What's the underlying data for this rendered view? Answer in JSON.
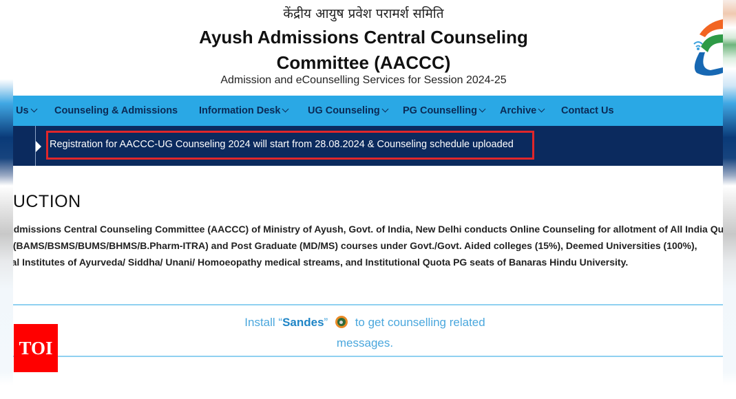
{
  "header": {
    "hindi_title": "केंद्रीय आयुष प्रवेश परामर्श समिति",
    "title_line1": "Ayush Admissions Central Counseling",
    "title_line2": "Committee (AACCC)",
    "subtitle": "Admission and eCounselling Services for Session 2024-25",
    "logo_icon": "india-gov-logo"
  },
  "nav": {
    "items": [
      {
        "label": "Us",
        "dropdown": true
      },
      {
        "label": "Counseling & Admissions",
        "dropdown": false
      },
      {
        "label": "Information Desk",
        "dropdown": true
      },
      {
        "label": "UG Counseling",
        "dropdown": true
      },
      {
        "label": "PG Counselling",
        "dropdown": true
      },
      {
        "label": "Archive",
        "dropdown": true
      },
      {
        "label": "Contact Us",
        "dropdown": false
      }
    ]
  },
  "ticker": {
    "text": "Registration for AACCC-UG Counseling 2024 will start from 28.08.2024 & Counseling schedule uploaded",
    "highlight_color": "#e0262a"
  },
  "intro": {
    "heading": "INTRODUCTION",
    "lines": [
      "Ayush Admissions Central Counseling Committee (AACCC) of Ministry of Ayush, Govt. of India, New Delhi conducts Online Counseling for allotment of All India Quota",
      "UG (BAMS/BSMS/BUMS/BHMS/B.Pharm-ITRA) and Post Graduate (MD/MS) courses under Govt./Govt. Aided colleges (15%), Deemed Universities (100%),",
      "National Institutes of Ayurveda/ Siddha/ Unani/ Homoeopathy medical streams, and Institutional Quota PG seats of Banaras Hindu University."
    ]
  },
  "sandes": {
    "prefix": "Install “",
    "app_name": "Sandes",
    "suffix_quote": "”",
    "rest": "to get counselling related",
    "line2": "messages.",
    "icon": "sandes-app-icon"
  },
  "watermark": {
    "label": "TOI"
  },
  "colors": {
    "nav_bg": "#2aa8e5",
    "ticker_bg": "#0b2a5e",
    "divider": "#8fd0f0",
    "toi_red": "#ff0000"
  }
}
